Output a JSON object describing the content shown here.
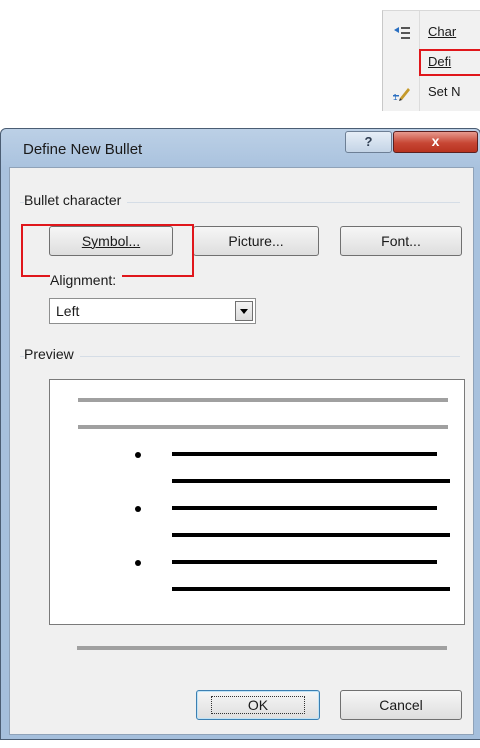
{
  "menu": {
    "items": [
      {
        "label": "Char",
        "icon": "change-list-level-icon"
      },
      {
        "label": "Defi",
        "icon": ""
      },
      {
        "label": "Set N",
        "icon": "set-numbering-value-icon"
      }
    ]
  },
  "dialog": {
    "title": "Define New Bullet",
    "help_label": "?",
    "close_label": "x",
    "bullet_character_label": "Bullet character",
    "symbol_label": "Symbol...",
    "picture_label": "Picture...",
    "font_label": "Font...",
    "alignment_label": "Alignment:",
    "alignment_value": "Left",
    "preview_label": "Preview",
    "ok_label": "OK",
    "cancel_label": "Cancel"
  },
  "colors": {
    "highlight": "#e0161b",
    "title_bar": "#a9c2de",
    "close_button": "#c74634"
  }
}
